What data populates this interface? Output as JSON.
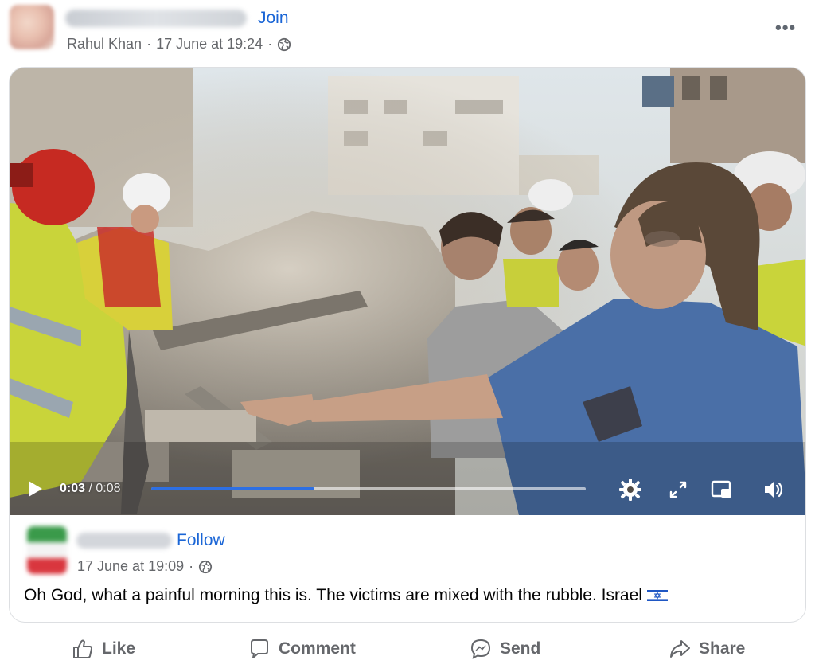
{
  "header": {
    "join_label": "Join",
    "author": "Rahul Khan",
    "separator": "·",
    "timestamp": "17 June at 19:24",
    "privacy_icon": "globe-icon",
    "more_label": "•••"
  },
  "video": {
    "current_time": "0:03",
    "time_separator": "/",
    "duration": "0:08",
    "progress": 0.375,
    "play_icon": "play-icon",
    "settings_icon": "gear-icon",
    "fullscreen_icon": "expand-icon",
    "pip_icon": "picture-in-picture-icon",
    "volume_icon": "volume-icon"
  },
  "shared_post": {
    "follow_label": "Follow",
    "timestamp": "17 June at 19:09",
    "separator": "·",
    "privacy_icon": "globe-icon",
    "text": "Oh God, what a painful morning this is. The victims are mixed with the rubble. Israel",
    "flag_icon": "israel-flag-icon"
  },
  "actions": [
    {
      "label": "Like",
      "icon": "thumbs-up-icon"
    },
    {
      "label": "Comment",
      "icon": "comment-icon"
    },
    {
      "label": "Send",
      "icon": "messenger-icon"
    },
    {
      "label": "Share",
      "icon": "share-icon"
    }
  ],
  "colors": {
    "link_blue": "#1b66d6",
    "meta_gray": "#65676b",
    "progress_blue": "#2d6fe3"
  }
}
